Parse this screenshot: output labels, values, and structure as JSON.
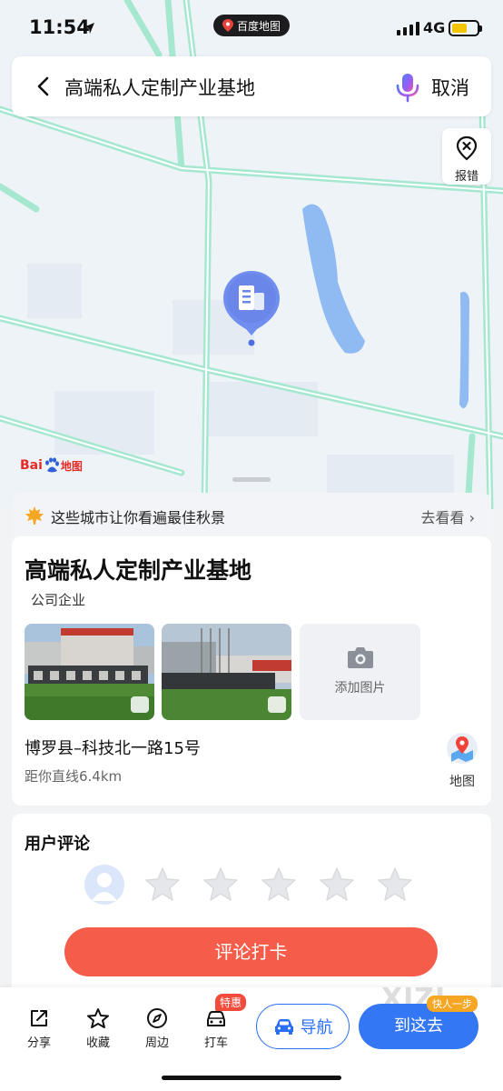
{
  "status_bar": {
    "time": "11:54",
    "app_pill": "百度地图",
    "network": "4G"
  },
  "search": {
    "query": "高端私人定制产业基地",
    "cancel_label": "取消"
  },
  "map": {
    "report_label": "报错",
    "logo_text_1": "Bai",
    "logo_text_2": "地图"
  },
  "promo": {
    "text": "这些城市让你看遍最佳秋景",
    "link": "去看看 ›"
  },
  "poi": {
    "title": "高端私人定制产业基地",
    "category": "公司企业",
    "add_photo_label": "添加图片",
    "address": "博罗县–科技北一路15号",
    "distance": "距你直线6.4km",
    "map_label": "地图"
  },
  "review": {
    "title": "用户评论",
    "button_label": "评论打卡",
    "stars_total": 5
  },
  "bottom_bar": {
    "share": "分享",
    "favorite": "收藏",
    "nearby": "周边",
    "taxi": "打车",
    "taxi_badge": "特惠",
    "navigate": "导航",
    "go_here": "到这去",
    "go_badge": "快人一步",
    "watermark": "XIZI"
  },
  "colors": {
    "accent_blue": "#3377f5",
    "review_red": "#f55d4a",
    "road_green": "#9fe4cc",
    "badge_red": "#f24b3c"
  }
}
